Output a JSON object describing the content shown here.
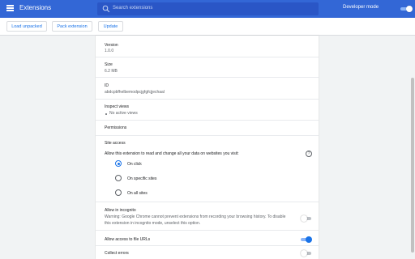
{
  "header": {
    "title": "Extensions",
    "search_placeholder": "Search extensions",
    "developer_mode_label": "Developer mode",
    "developer_mode_on": true
  },
  "toolbar": {
    "load_unpacked": "Load unpacked",
    "pack_extension": "Pack extension",
    "update": "Update"
  },
  "details": {
    "version": {
      "label": "Version",
      "value": "1.0.0"
    },
    "size": {
      "label": "Size",
      "value": "6.2 MB"
    },
    "id": {
      "label": "ID",
      "value": "abdcpbfhelbemodpcjgfgfcjjechaal"
    },
    "inspect": {
      "label": "Inspect views",
      "value": "No active views"
    },
    "permissions": {
      "label": "Permissions"
    },
    "site_access": {
      "label": "Site access",
      "description": "Allow this extension to read and change all your data on websites you visit:",
      "options": [
        "On click",
        "On specific sites",
        "On all sites"
      ],
      "selected": "On click"
    },
    "incognito": {
      "label": "Allow in incognito",
      "warning_line1": "Warning: Google Chrome cannot prevent extensions from recording your browsing history. To disable",
      "warning_line2": "this extension in incognito mode, unselect this option.",
      "enabled": false
    },
    "file_urls": {
      "label": "Allow access to file URLs",
      "enabled": true
    },
    "collect_errors": {
      "label": "Collect errors",
      "enabled": false
    }
  },
  "colors": {
    "header": "#3367d6",
    "accent": "#1a73e8",
    "background": "#f1f3f4"
  }
}
